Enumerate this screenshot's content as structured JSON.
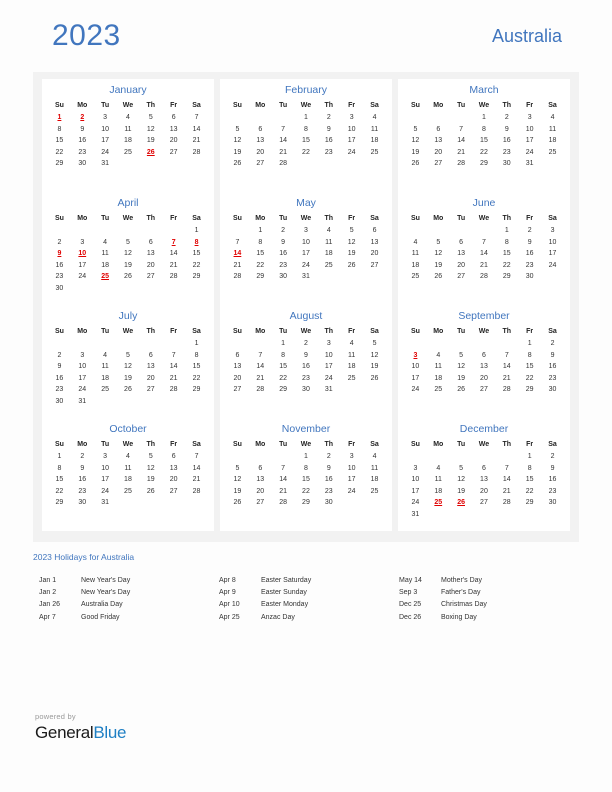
{
  "header": {
    "year": "2023",
    "country": "Australia"
  },
  "colors": {
    "accent_blue": "#4176be",
    "holiday_red": "#e00000",
    "container_bg": "#f2f2f2",
    "card_bg": "#ffffff",
    "logo_blue": "#1e7fc4"
  },
  "weekday_headers": [
    "Su",
    "Mo",
    "Tu",
    "We",
    "Th",
    "Fr",
    "Sa"
  ],
  "months": [
    {
      "name": "January",
      "lead_blank": 0,
      "days": 31,
      "holidays": [
        1,
        2,
        26
      ]
    },
    {
      "name": "February",
      "lead_blank": 3,
      "days": 28,
      "holidays": []
    },
    {
      "name": "March",
      "lead_blank": 3,
      "days": 31,
      "holidays": []
    },
    {
      "name": "April",
      "lead_blank": 6,
      "days": 30,
      "holidays": [
        7,
        8,
        9,
        10,
        25
      ]
    },
    {
      "name": "May",
      "lead_blank": 1,
      "days": 31,
      "holidays": [
        14
      ]
    },
    {
      "name": "June",
      "lead_blank": 4,
      "days": 30,
      "holidays": []
    },
    {
      "name": "July",
      "lead_blank": 6,
      "days": 31,
      "holidays": []
    },
    {
      "name": "August",
      "lead_blank": 2,
      "days": 31,
      "holidays": []
    },
    {
      "name": "September",
      "lead_blank": 5,
      "days": 30,
      "holidays": [
        3
      ]
    },
    {
      "name": "October",
      "lead_blank": 0,
      "days": 31,
      "holidays": []
    },
    {
      "name": "November",
      "lead_blank": 3,
      "days": 30,
      "holidays": []
    },
    {
      "name": "December",
      "lead_blank": 5,
      "days": 31,
      "holidays": [
        25,
        26
      ]
    }
  ],
  "holidays_section": {
    "heading": "2023 Holidays for Australia",
    "columns": [
      [
        {
          "date": "Jan 1",
          "name": "New Year's Day"
        },
        {
          "date": "Jan 2",
          "name": "New Year's Day"
        },
        {
          "date": "Jan 26",
          "name": "Australia Day"
        },
        {
          "date": "Apr 7",
          "name": "Good Friday"
        }
      ],
      [
        {
          "date": "Apr 8",
          "name": "Easter Saturday"
        },
        {
          "date": "Apr 9",
          "name": "Easter Sunday"
        },
        {
          "date": "Apr 10",
          "name": "Easter Monday"
        },
        {
          "date": "Apr 25",
          "name": "Anzac Day"
        }
      ],
      [
        {
          "date": "May 14",
          "name": "Mother's Day"
        },
        {
          "date": "Sep 3",
          "name": "Father's Day"
        },
        {
          "date": "Dec 25",
          "name": "Christmas Day"
        },
        {
          "date": "Dec 26",
          "name": "Boxing Day"
        }
      ]
    ]
  },
  "footer": {
    "powered_by": "powered by",
    "logo_part1": "General",
    "logo_part2": "Blue"
  }
}
